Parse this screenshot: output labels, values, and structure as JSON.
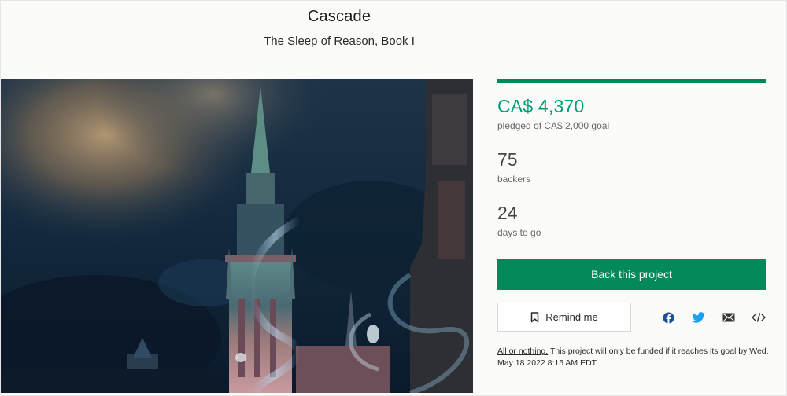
{
  "project": {
    "title": "Cascade",
    "subtitle": "The Sleep of Reason, Book I"
  },
  "stats": {
    "progress_fraction": 1.0,
    "pledged_amount": "CA$ 4,370",
    "pledged_label": "pledged of CA$ 2,000 goal",
    "backers_count": "75",
    "backers_label": "backers",
    "days_count": "24",
    "days_label": "days to go"
  },
  "actions": {
    "back_label": "Back this project",
    "remind_label": "Remind me"
  },
  "share": [
    {
      "icon": "facebook-icon",
      "color": "#1e4f9c"
    },
    {
      "icon": "twitter-icon",
      "color": "#1da1f2"
    },
    {
      "icon": "mail-icon",
      "color": "#353535"
    },
    {
      "icon": "embed-icon",
      "color": "#353535"
    }
  ],
  "footnote": {
    "link_label": "All or nothing.",
    "text": " This project will only be funded if it reaches its goal by Wed, May 18 2022 8:15 AM EDT."
  },
  "colors": {
    "accent_green": "#038a58",
    "amount_green": "#009e74"
  }
}
